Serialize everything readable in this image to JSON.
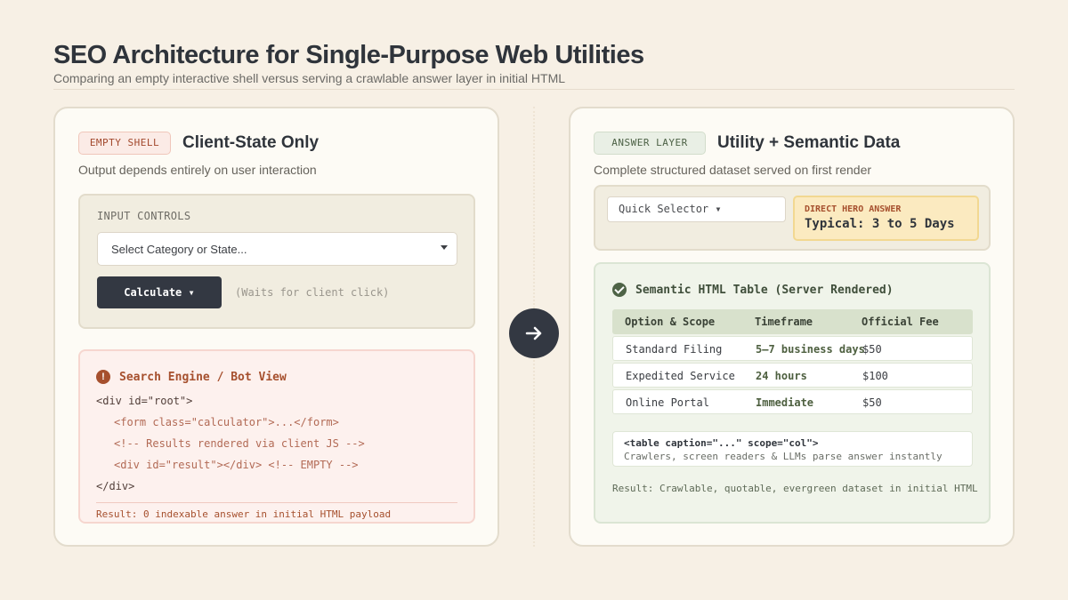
{
  "header": {
    "title": "SEO Architecture for Single-Purpose Web Utilities",
    "subtitle": "Comparing an empty interactive shell versus serving a crawlable answer layer in initial HTML"
  },
  "left": {
    "tag": "EMPTY SHELL",
    "title": "Client-State Only",
    "description": "Output depends entirely on user interaction",
    "controls": {
      "label": "INPUT CONTROLS",
      "select_placeholder": "Select Category or State...",
      "button_label": "Calculate ▾",
      "note": "(Waits for client click)"
    },
    "bot_view": {
      "title": "Search Engine / Bot View",
      "lines": [
        "<div id=\"root\">",
        "<form class=\"calculator\">...</form>",
        "<!-- Results rendered via client JS -->",
        "<div id=\"result\"></div> <!-- EMPTY -->",
        "</div>"
      ],
      "result": "Result: 0 indexable answer in initial HTML payload"
    }
  },
  "right": {
    "tag": "ANSWER LAYER",
    "title": "Utility + Semantic Data",
    "description": "Complete structured dataset served on first render",
    "quick_selector": "Quick Selector ▾",
    "hero": {
      "label": "DIRECT HERO ANSWER",
      "value": "Typical: 3 to 5 Days"
    },
    "table": {
      "title": "Semantic HTML Table (Server Rendered)",
      "headers": [
        "Option & Scope",
        "Timeframe",
        "Official Fee"
      ],
      "rows": [
        [
          "Standard Filing",
          "5–7 business days",
          "$50"
        ],
        [
          "Expedited Service",
          "24 hours",
          "$100"
        ],
        [
          "Online Portal",
          "Immediate",
          "$50"
        ]
      ],
      "hint_code": "<table caption=\"...\" scope=\"col\">",
      "hint_desc": "Crawlers, screen readers & LLMs parse answer instantly",
      "result": "Result: Crawlable, quotable, evergreen dataset in initial HTML"
    }
  },
  "colors": {
    "background": "#f7f0e5",
    "dark": "#333842",
    "accent_red": "#a6502e",
    "accent_green": "#4e6346",
    "hero_bg": "#fbeac0"
  }
}
